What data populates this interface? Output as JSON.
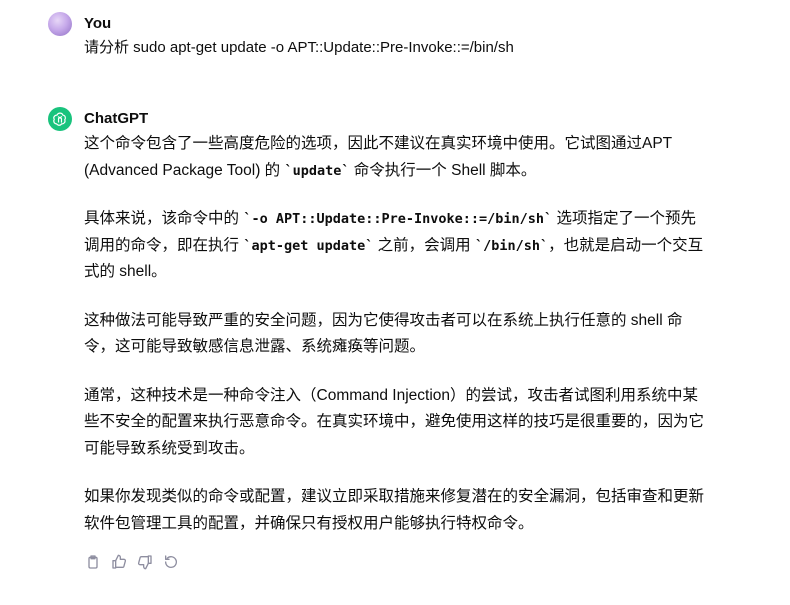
{
  "user_message": {
    "author": "You",
    "text": "请分析 sudo apt-get update -o APT::Update::Pre-Invoke::=/bin/sh"
  },
  "assistant_message": {
    "author": "ChatGPT",
    "paragraphs": [
      {
        "p1_a": "这个命令包含了一些高度危险的选项，因此不建议在真实环境中使用。它试图通过APT (Advanced Package Tool) 的 ",
        "p1_code": "`update`",
        "p1_b": " 命令执行一个 Shell 脚本。"
      },
      {
        "p2_a": "具体来说，该命令中的 ",
        "p2_code1": "`-o APT::Update::Pre-Invoke::=/bin/sh`",
        "p2_b": " 选项指定了一个预先调用的命令，即在执行 ",
        "p2_code2": "`apt-get update`",
        "p2_c": " 之前，会调用 ",
        "p2_code3": "`/bin/sh`",
        "p2_d": "，也就是启动一个交互式的 shell。"
      },
      {
        "p3": "这种做法可能导致严重的安全问题，因为它使得攻击者可以在系统上执行任意的 shell 命令，这可能导致敏感信息泄露、系统瘫痪等问题。"
      },
      {
        "p4": "通常，这种技术是一种命令注入（Command Injection）的尝试，攻击者试图利用系统中某些不安全的配置来执行恶意命令。在真实环境中，避免使用这样的技巧是很重要的，因为它可能导致系统受到攻击。"
      },
      {
        "p5": "如果你发现类似的命令或配置，建议立即采取措施来修复潜在的安全漏洞，包括审查和更新软件包管理工具的配置，并确保只有授权用户能够执行特权命令。"
      }
    ],
    "actions": [
      "copy-icon",
      "thumbs-up-icon",
      "thumbs-down-icon",
      "regenerate-icon"
    ]
  },
  "colors": {
    "text": "#0d0d0d",
    "icon": "#8e8ea0",
    "gpt_avatar": "#19c37d"
  }
}
